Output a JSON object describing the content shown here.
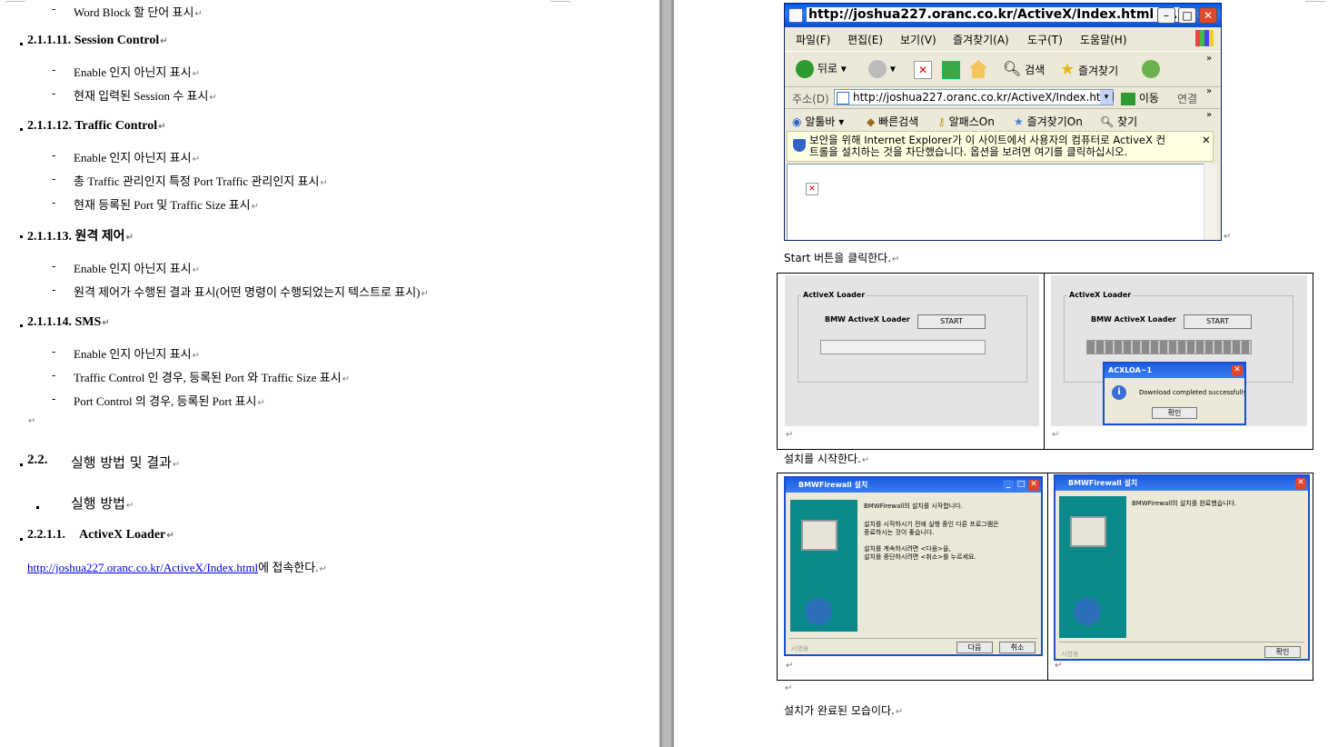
{
  "left_page": {
    "top_item": "Word Block 할 단어 표시",
    "sections": [
      {
        "num": "2.1.1.11.",
        "title": "Session Control",
        "items": [
          "Enable 인지 아닌지 표시",
          "현재 입력된 Session 수 표시"
        ]
      },
      {
        "num": "2.1.1.12.",
        "title": "Traffic Control",
        "items": [
          "Enable 인지 아닌지 표시",
          "총 Traffic 관리인지 특정 Port Traffic 관리인지 표시",
          "현재 등록된 Port 및 Traffic Size 표시"
        ]
      },
      {
        "num": "2.1.1.13.",
        "title": "원격 제어",
        "items": [
          "Enable 인지 아닌지 표시",
          "원격 제어가 수행된 결과 표시(어떤 명령이 수행되었는지 텍스트로 표시)"
        ]
      },
      {
        "num": "2.1.1.14.",
        "title": "SMS",
        "items": [
          "Enable 인지 아닌지 표시",
          "Traffic Control 인 경우, 등록된 Port 와 Traffic Size 표시",
          "Port Control 의 경우, 등록된 Port 표시"
        ]
      }
    ],
    "section_22_num": "2.2.",
    "section_22_title": "실행 방법 및 결과",
    "sub_heading": "실행 방법",
    "section_221_num": "2.2.1.1.",
    "section_221_title": "ActiveX Loader",
    "link_text": "http://joshua227.oranc.co.kr/ActiveX/Index.html",
    "link_suffix": "에 접속한다.",
    "para_mark": "↵"
  },
  "browser": {
    "title": "http://joshua227.oranc.co.kr/ActiveX/Index.html - ...",
    "menu": [
      "파일(F)",
      "편집(E)",
      "보기(V)",
      "즐겨찾기(A)",
      "도구(T)",
      "도움말(H)"
    ],
    "toolbar": {
      "back": "뒤로",
      "search": "검색",
      "favorites": "즐겨찾기"
    },
    "address_label": "주소(D)",
    "address_value": "http://joshua227.oranc.co.kr/ActiveX/Index.html",
    "go_label": "이동",
    "links_label": "연결",
    "links_bar": [
      "알툴바",
      "빠른검색",
      "알패스On",
      "즐겨찾기On",
      "찾기"
    ],
    "info_bar_line1": "보안을 위해 Internet Explorer가 이 사이트에서 사용자의 컴퓨터로 ActiveX 컨",
    "info_bar_line2": "트롤을 설치하는 것을 차단했습니다. 옵션을 보려면 여기를 클릭하십시오."
  },
  "right_page": {
    "caption_start": "Start 버튼을 클릭한다.",
    "caption_install": "설치를 시작한다.",
    "caption_done": "설치가 완료된 모습이다.",
    "loader": {
      "group_title": "ActiveX Loader",
      "label": "BMW ActiveX Loader",
      "button": "START",
      "dialog_title": "ACXLOA~1",
      "dialog_msg": "Download completed successfully!",
      "dialog_ok": "확인"
    },
    "installer": {
      "title": "BMWFirewall 설치",
      "start_line1": "BMWFirewall의 설치를 시작합니다.",
      "start_line2": "설치를 시작하시기 전에 실행 중인 다른 프로그램은",
      "start_line3": "종료하시는 것이 좋습니다.",
      "start_line4": "설치를 계속하시려면 <다음>을,",
      "start_line5": "설치를 중단하시려면 <취소>를 누르세요.",
      "next": "다음",
      "cancel": "취소",
      "done_line": "BMWFirewall의 설치를 완료했습니다.",
      "ok": "확인",
      "footer": "시영용"
    }
  }
}
